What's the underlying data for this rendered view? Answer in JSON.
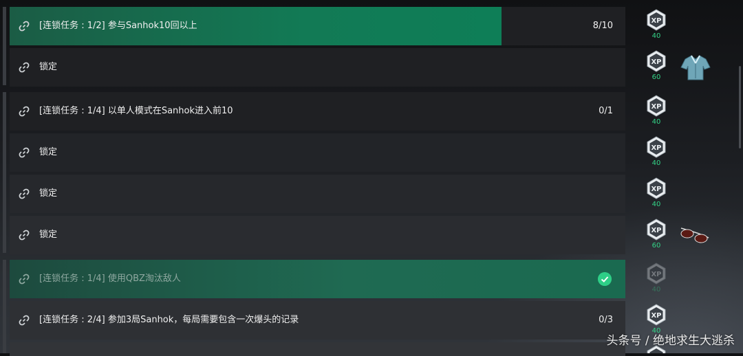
{
  "missions": [
    {
      "label": "[连锁任务 : 1/2] 参与Sanhok10回以上",
      "count": "8/10",
      "progress": 0.8,
      "state": "active"
    },
    {
      "label": "锁定",
      "count": "",
      "state": "locked"
    },
    {
      "label": "[连锁任务 : 1/4] 以单人模式在Sanhok进入前10",
      "count": "0/1",
      "progress": 0,
      "state": "active"
    },
    {
      "label": "锁定",
      "count": "",
      "state": "locked"
    },
    {
      "label": "锁定",
      "count": "",
      "state": "locked"
    },
    {
      "label": "锁定",
      "count": "",
      "state": "locked"
    },
    {
      "label": "[连锁任务 : 1/4] 使用QBZ淘汰敌人",
      "count": "",
      "state": "completed"
    },
    {
      "label": "[连锁任务 : 2/4] 参加3局Sanhok，每局需要包含一次爆头的记录",
      "count": "0/3",
      "progress": 0,
      "state": "active"
    }
  ],
  "xp_rewards": [
    {
      "icon": "xp-badge-icon",
      "amount": "40"
    },
    {
      "icon": "xp-badge-icon",
      "amount": "60"
    },
    {
      "icon": "xp-badge-icon",
      "amount": "40"
    },
    {
      "icon": "xp-badge-icon",
      "amount": "40"
    },
    {
      "icon": "xp-badge-icon",
      "amount": "40"
    },
    {
      "icon": "xp-badge-icon",
      "amount": "60"
    },
    {
      "icon": "xp-badge-icon",
      "amount": "40"
    },
    {
      "icon": "xp-badge-icon",
      "amount": "40"
    }
  ],
  "item_rewards": [
    "shirt-reward-icon",
    "sunglasses-reward-icon"
  ],
  "colors": {
    "accent": "#2ecf87",
    "progress_fill": "#127a55",
    "row_bg": "#1f2023",
    "xp_text": "#33d487"
  },
  "watermark": "头条号 / 绝地求生大逃杀"
}
